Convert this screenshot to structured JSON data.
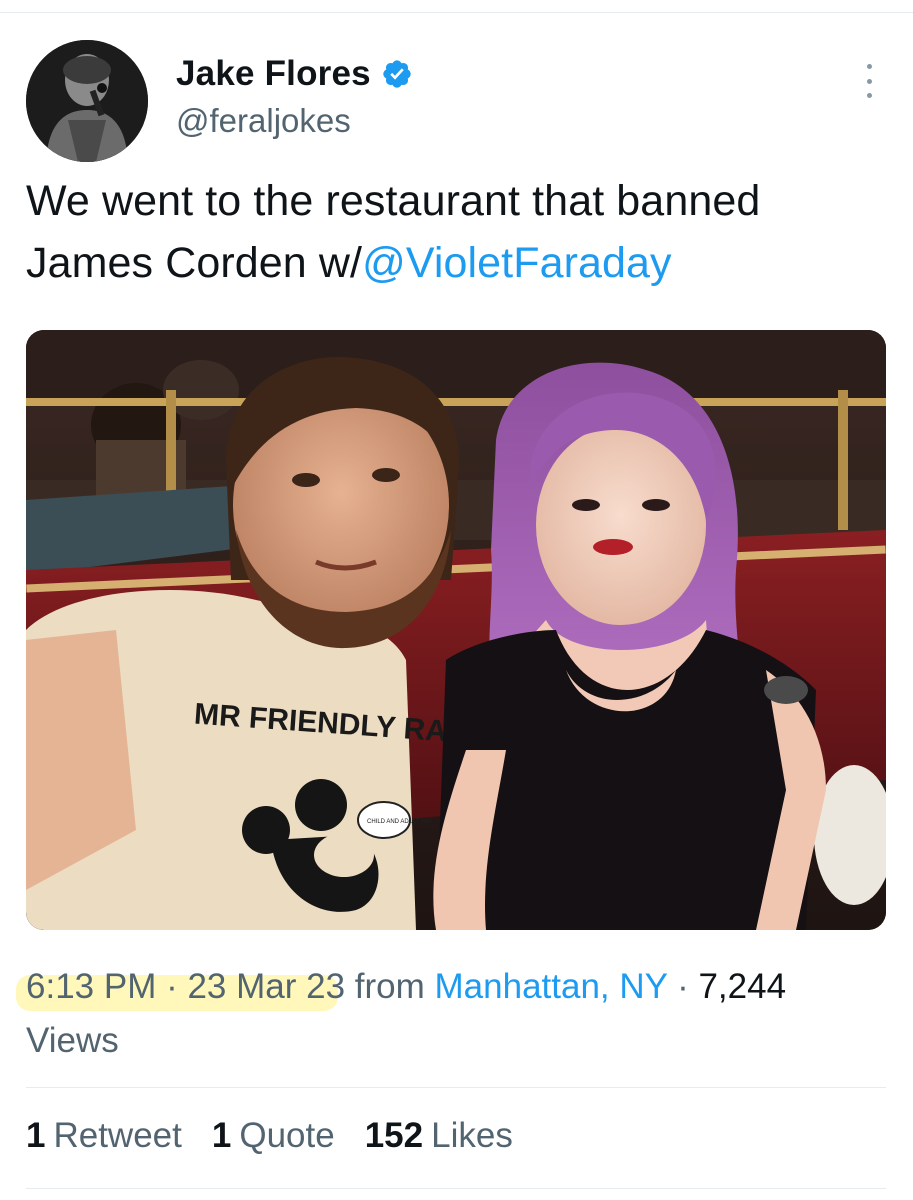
{
  "author": {
    "display_name": "Jake Flores",
    "handle": "@feraljokes",
    "verified_icon": "verified-badge-icon",
    "verified_color": "#1d9bf0"
  },
  "tweet": {
    "text_before_mention": "We went to the restaurant that banned James Corden w/",
    "mention": "@VioletFaraday",
    "mention_color": "#1d9bf0"
  },
  "media": {
    "shirt_text": "MR FRIENDLY RAT",
    "speech_bubble_text": "CHILD AND ADULT RAT"
  },
  "meta": {
    "time": "6:13 PM",
    "separator_1": " · ",
    "date": "23 Mar 23",
    "from_label": " from ",
    "location": "Manhattan, NY",
    "separator_2": " · ",
    "views_count": "7,244",
    "views_label": "Views",
    "highlight_color": "#fff38c"
  },
  "stats": {
    "retweets_count": "1",
    "retweets_label": "Retweet",
    "quotes_count": "1",
    "quotes_label": "Quote",
    "likes_count": "152",
    "likes_label": "Likes"
  }
}
